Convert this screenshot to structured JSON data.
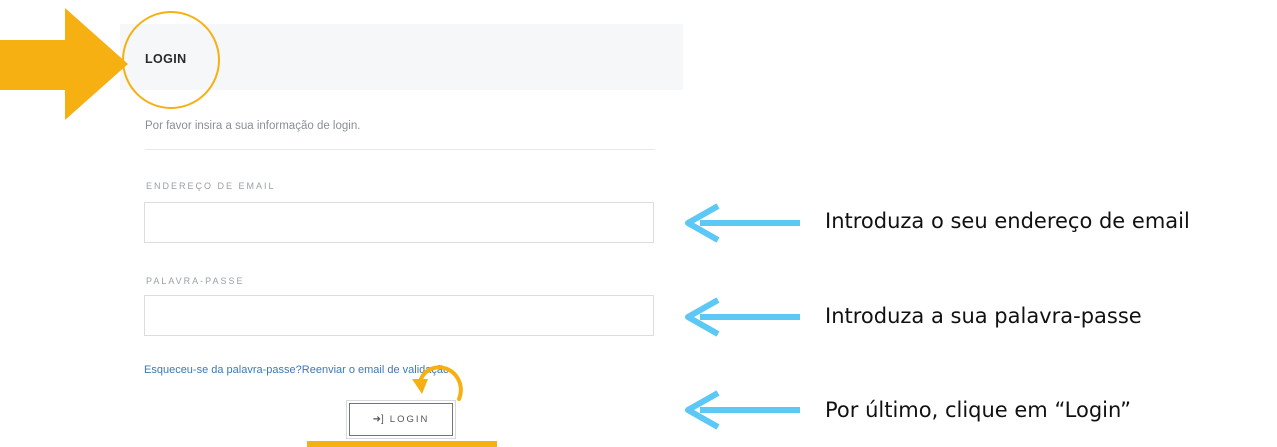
{
  "login_form": {
    "title": "LOGIN",
    "intro": "Por favor insira a sua informação de login.",
    "email_label": "ENDEREÇO DE EMAIL",
    "email_value": "",
    "password_label": "PALAVRA-PASSE",
    "password_value": "",
    "forgot_link": "Esqueceu-se da palavra-passe?",
    "resend_link": "Reenviar o email de validação.",
    "submit_icon": "sign-in-icon",
    "submit_label": "LOGIN"
  },
  "annotations": {
    "email_instruction": "Introduza o seu endereço de email",
    "password_instruction": "Introduza a sua palavra-passe",
    "login_instruction": "Por último, clique em “Login”",
    "highlight_color": "#f6b012",
    "arrow_color": "#5bc8f5"
  }
}
